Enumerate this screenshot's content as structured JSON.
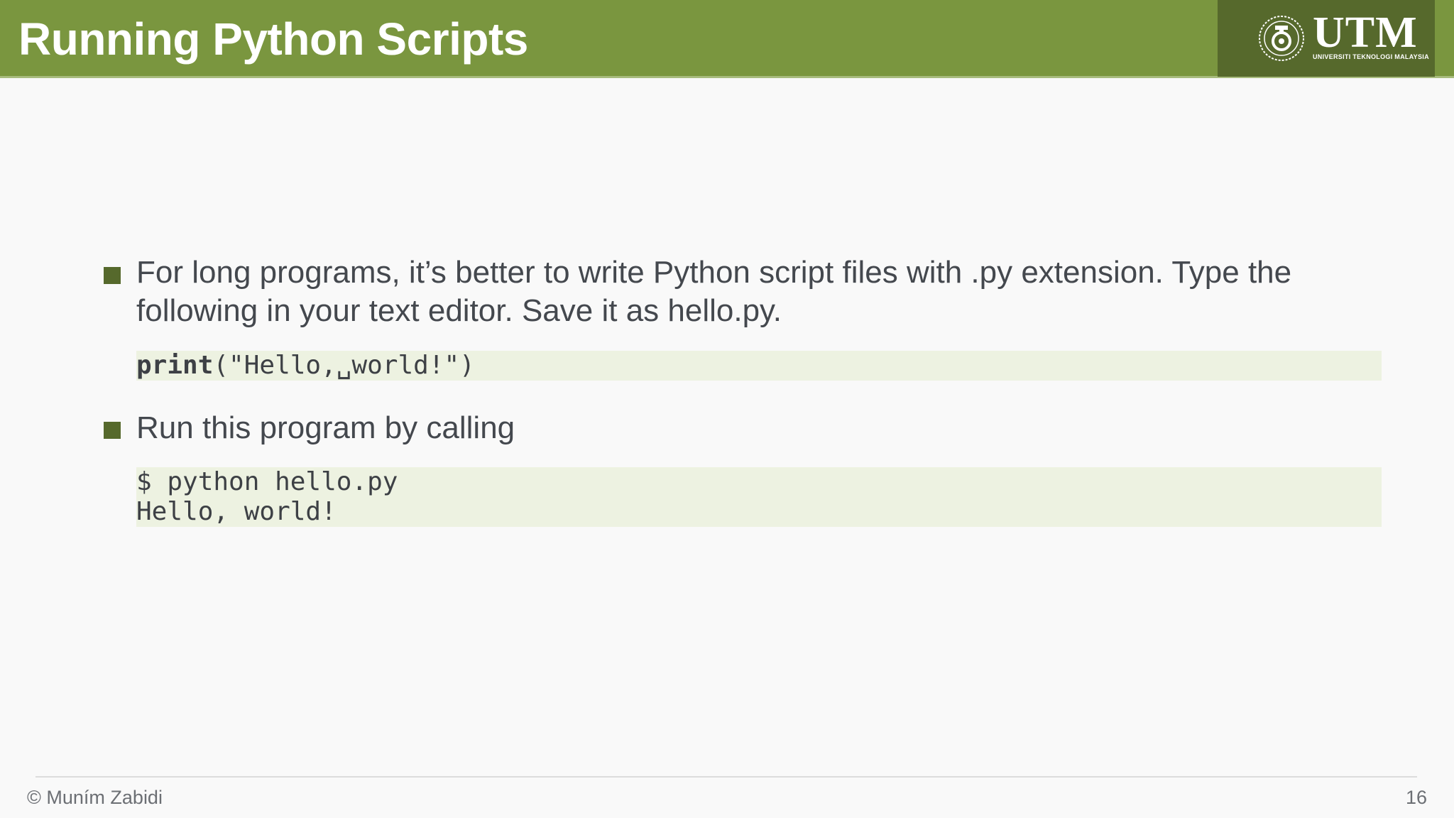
{
  "slide": {
    "title": "Running Python Scripts",
    "logo": {
      "name": "UTM",
      "subtitle": "UNIVERSITI TEKNOLOGI MALAYSIA"
    },
    "bullets": [
      {
        "text": "For long programs, it’s better to write Python script files with .py extension. Type the following in your text editor. Save it as hello.py."
      },
      {
        "text": "Run this program by calling"
      }
    ],
    "code1": {
      "keyword": "print",
      "rest": "(\"Hello,␣world!\")"
    },
    "code2": {
      "line1": "$ python hello.py",
      "line2": "Hello, world!"
    },
    "footer": {
      "author": "© Muním Zabidi",
      "page_number": "16"
    }
  }
}
